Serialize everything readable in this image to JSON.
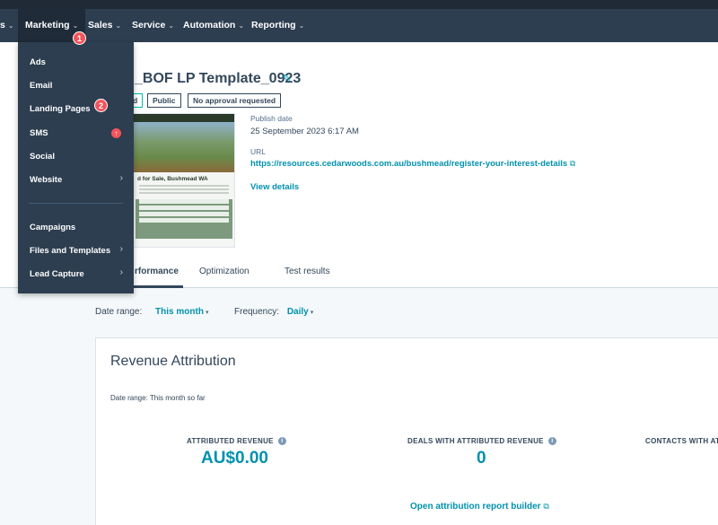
{
  "topnav": {
    "items": [
      {
        "label": "s",
        "chevron": "⌄"
      },
      {
        "label": "Marketing",
        "chevron": "⌄"
      },
      {
        "label": "Sales",
        "chevron": "⌄"
      },
      {
        "label": "Service",
        "chevron": "⌄"
      },
      {
        "label": "Automation",
        "chevron": "⌄"
      },
      {
        "label": "Reporting",
        "chevron": "⌄"
      }
    ],
    "step_badge_1": "1",
    "step_badge_2": "2"
  },
  "marketing_menu": {
    "items": [
      {
        "label": "Ads"
      },
      {
        "label": "Email"
      },
      {
        "label": "Landing Pages"
      },
      {
        "label": "SMS"
      },
      {
        "label": "Social"
      },
      {
        "label": "Website",
        "arrow": "›"
      },
      {
        "label": "Campaigns"
      },
      {
        "label": "Files and Templates",
        "arrow": "›"
      },
      {
        "label": "Lead Capture",
        "arrow": "›"
      }
    ],
    "sms_upgrade_icon": "↑"
  },
  "page": {
    "title": "_BOF LP Template_0923",
    "tags": [
      "d",
      "Public",
      "No approval requested"
    ],
    "publish_date_label": "Publish date",
    "publish_date_value": "25 September 2023 6:17 AM",
    "url_label": "URL",
    "url_value": "https://resources.cedarwoods.com.au/bushmead/register-your-interest-details",
    "view_details": "View details",
    "thumbnail_title": "d for Sale, Bushmead WA"
  },
  "tabs": [
    "rformance",
    "Optimization",
    "Test results"
  ],
  "filters": {
    "date_range_label": "Date range:",
    "date_range_value": "This month",
    "frequency_label": "Frequency:",
    "frequency_value": "Daily"
  },
  "revenue_card": {
    "title": "Revenue Attribution",
    "subtitle": "Date range: This month so far",
    "kpis": [
      {
        "label": "ATTRIBUTED REVENUE",
        "value": "AU$0.00"
      },
      {
        "label": "DEALS WITH ATTRIBUTED REVENUE",
        "value": "0"
      },
      {
        "label": "CONTACTS WITH AT",
        "value": ""
      }
    ],
    "report_link": "Open attribution report builder"
  },
  "icons": {
    "edit": "edit-pencil-icon",
    "external": "external-link-icon",
    "info": "info-icon",
    "chevron": "chevron-down-icon",
    "arrow": "chevron-right-icon"
  },
  "colors": {
    "nav_bg": "#2d3e50",
    "accent": "#0091ae",
    "badge": "#f2545b",
    "text": "#33475b"
  }
}
